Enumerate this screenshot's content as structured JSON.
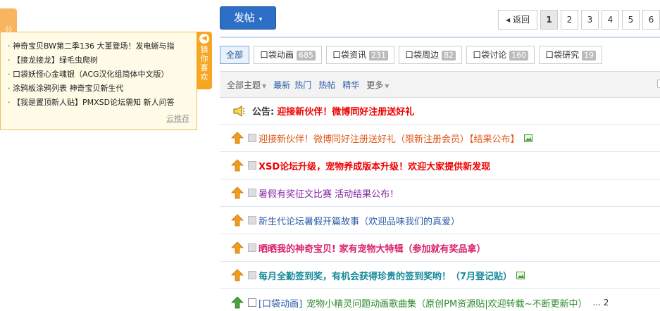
{
  "left_panel": {
    "tab_label": "公",
    "guess_tab": {
      "arrow": "◀",
      "label": "猜你喜欢"
    },
    "items": [
      "神奇宝贝BW第二季136 大堇登场！发电蜥与指",
      "【接龙接龙】绿毛虫爬树",
      "口袋妖怪心金魂银（ACG汉化组简体中文版）",
      "涂鸦板涂鸦列表 神奇宝贝新生代",
      "【我是置顶新人贴】PMXSD论坛需知 新人问答"
    ],
    "more_link": "云推荐"
  },
  "toolbar": {
    "post_label": "发帖",
    "post_caret": "▾"
  },
  "pager": {
    "back_label": "◂ 返回",
    "pages": [
      "1",
      "2",
      "3",
      "4",
      "5",
      "6"
    ],
    "current": "1"
  },
  "categories": [
    {
      "label": "全部",
      "count": ""
    },
    {
      "label": "口袋动画",
      "count": "685"
    },
    {
      "label": "口袋资讯",
      "count": "231"
    },
    {
      "label": "口袋周边",
      "count": "82"
    },
    {
      "label": "口袋讨论",
      "count": "160"
    },
    {
      "label": "口袋研究",
      "count": "19"
    }
  ],
  "filter_bar": {
    "all_topics": "全部主题",
    "latest": "最新",
    "hot": "热门",
    "hot_posts": "热帖",
    "digest": "精华",
    "more": "更多"
  },
  "announcement": {
    "label": "公告:",
    "title": "迎接新伙伴！微博同好注册送好礼"
  },
  "threads": [
    {
      "title": "迎接新伙伴！微博同好注册送好礼（限新注册会员）【结果公布】",
      "style": "t-orange",
      "has_image": true,
      "tag": "",
      "tail": ""
    },
    {
      "title": "XSD论坛升级，宠物养成版本升级！欢迎大家提供新发现",
      "style": "t-red",
      "has_image": false,
      "tag": "",
      "tail": ""
    },
    {
      "title": "暑假有奖征文比赛 活动结果公布！",
      "style": "t-purple",
      "has_image": false,
      "tag": "",
      "tail": ""
    },
    {
      "title": "新生代论坛暑假开篇故事（欢迎品味我们的真爱）",
      "style": "t-blue",
      "has_image": false,
      "tag": "",
      "tail": ""
    },
    {
      "title": "晒晒我的神奇宝贝! 家有宠物大特辑（参加就有奖品拿）",
      "style": "t-pink",
      "has_image": false,
      "tag": "",
      "tail": ""
    },
    {
      "title": "每月全勤签到奖，有机会获得珍贵的签到奖哟！（7月登记贴）",
      "style": "t-teal",
      "has_image": true,
      "tag": "",
      "tail": ""
    },
    {
      "title": "宠物小精灵问题动画歌曲集（原创PM资源贴|欢迎转载~不断更新中）",
      "style": "t-green",
      "has_image": false,
      "tag": "[口袋动画]",
      "tail": "... 2"
    }
  ],
  "colors": {
    "accent_blue": "#2d6fc7",
    "panel_yellow": "#fffbe6",
    "tab_orange": "#f6a623",
    "sticky_orange": "#f29b1c",
    "normal_green": "#4aa23a"
  },
  "icons": {
    "speaker": "megaphone-icon",
    "sticky": "arrow-up-icon",
    "attachment": "image-icon"
  }
}
